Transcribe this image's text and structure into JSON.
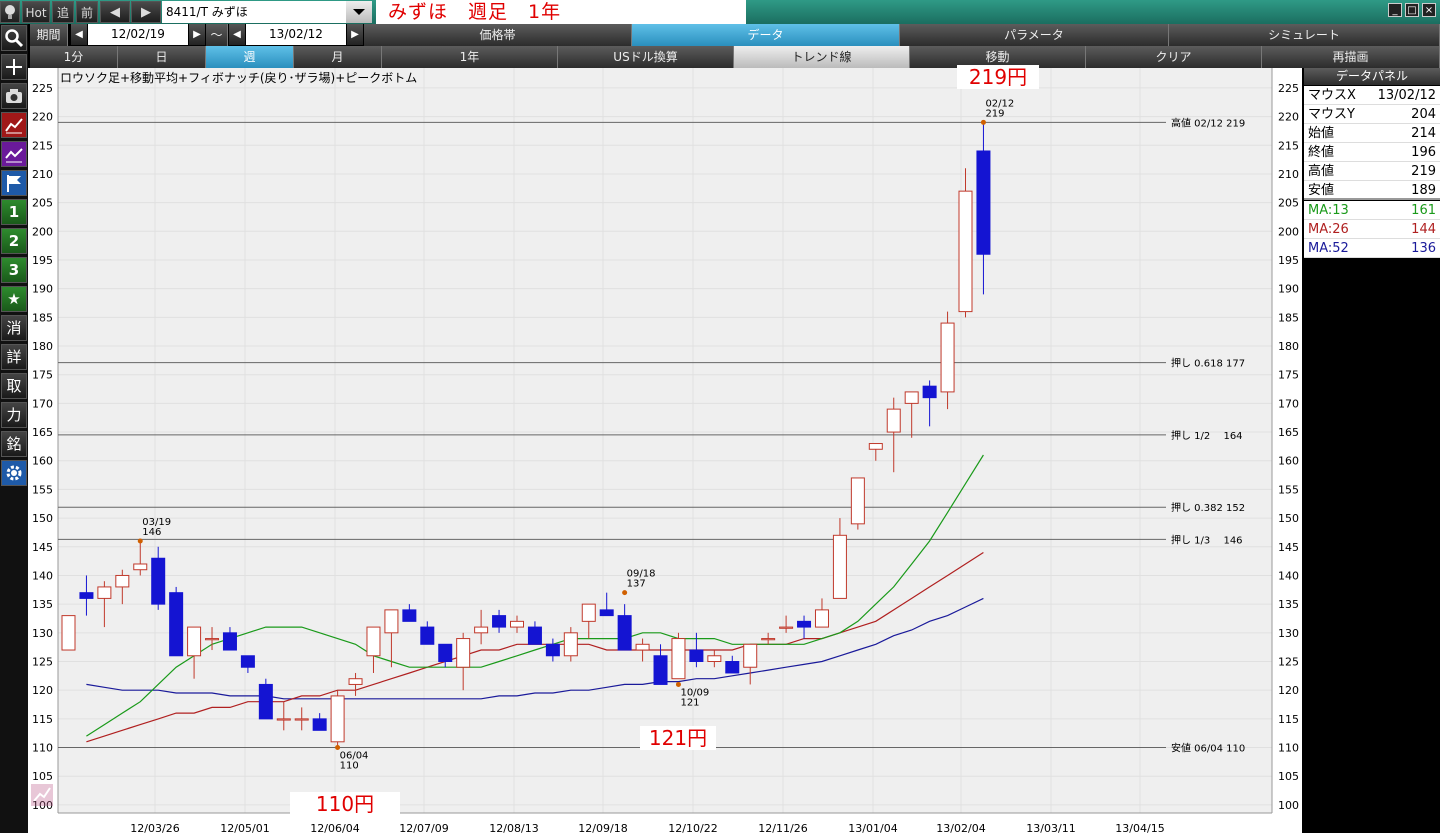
{
  "toolbar": {
    "hot": "Hot",
    "tsui": "追",
    "mae": "前",
    "prev": "◀",
    "next": "▶",
    "symbol": "8411/T みずほ",
    "title": "みずほ　週足　1年",
    "win_min": "_",
    "win_max": "□",
    "win_close": "×"
  },
  "left_tools": [
    "search-icon",
    "plus-icon",
    "camera-icon",
    "chart-line-icon",
    "chart-purple-icon",
    "flag-icon",
    "1",
    "2",
    "3",
    "★",
    "消",
    "詳",
    "取",
    "力",
    "銘",
    "gear-icon"
  ],
  "period": {
    "label": "期間",
    "from": "12/02/19",
    "tilde": "～",
    "to": "13/02/12"
  },
  "row1_tabs": [
    {
      "label": "価格帯",
      "selected": false
    },
    {
      "label": "データ",
      "selected": true
    },
    {
      "label": "パラメータ",
      "selected": false
    },
    {
      "label": "シミュレート",
      "selected": false
    }
  ],
  "row2_tabs": [
    {
      "label": "1分",
      "selected": false
    },
    {
      "label": "日",
      "selected": false
    },
    {
      "label": "週",
      "selected": true
    },
    {
      "label": "月",
      "selected": false
    },
    {
      "label": "1年",
      "selected": false
    },
    {
      "label": "USドル換算",
      "selected": false
    },
    {
      "label": "トレンド線",
      "selected": false
    },
    {
      "label": "移動",
      "selected": false
    },
    {
      "label": "クリア",
      "selected": false
    },
    {
      "label": "再描画",
      "selected": false
    }
  ],
  "chart_title": "ロウソク足+移動平均+フィボナッチ(戻り･ザラ場)+ピークボトム",
  "chart_data": {
    "type": "candlestick",
    "ylim": [
      100,
      228
    ],
    "yticks": [
      100,
      105,
      110,
      115,
      120,
      125,
      130,
      135,
      140,
      145,
      150,
      155,
      160,
      165,
      170,
      175,
      180,
      185,
      190,
      195,
      200,
      205,
      210,
      215,
      220,
      225
    ],
    "xticks": [
      "12/03/26",
      "12/05/01",
      "12/06/04",
      "12/07/09",
      "12/08/13",
      "12/09/18",
      "12/10/22",
      "12/11/26",
      "13/01/04",
      "13/02/04",
      "13/03/11",
      "13/04/15"
    ],
    "candles": [
      {
        "o": 127,
        "h": 133,
        "l": 127,
        "c": 133
      },
      {
        "o": 137,
        "h": 140,
        "l": 133,
        "c": 136
      },
      {
        "o": 136,
        "h": 139,
        "l": 131,
        "c": 138
      },
      {
        "o": 138,
        "h": 141,
        "l": 135,
        "c": 140
      },
      {
        "o": 141,
        "h": 146,
        "l": 140,
        "c": 142
      },
      {
        "o": 143,
        "h": 145,
        "l": 134,
        "c": 135
      },
      {
        "o": 137,
        "h": 138,
        "l": 126,
        "c": 126
      },
      {
        "o": 126,
        "h": 131,
        "l": 122,
        "c": 131
      },
      {
        "o": 129,
        "h": 131,
        "l": 127,
        "c": 129
      },
      {
        "o": 130,
        "h": 131,
        "l": 127,
        "c": 127
      },
      {
        "o": 126,
        "h": 126,
        "l": 123,
        "c": 124
      },
      {
        "o": 121,
        "h": 122,
        "l": 115,
        "c": 115
      },
      {
        "o": 115,
        "h": 118,
        "l": 113,
        "c": 115
      },
      {
        "o": 115,
        "h": 117,
        "l": 113,
        "c": 115
      },
      {
        "o": 115,
        "h": 116,
        "l": 113,
        "c": 113
      },
      {
        "o": 111,
        "h": 120,
        "l": 110,
        "c": 119
      },
      {
        "o": 121,
        "h": 123,
        "l": 119,
        "c": 122
      },
      {
        "o": 126,
        "h": 131,
        "l": 123,
        "c": 131
      },
      {
        "o": 130,
        "h": 134,
        "l": 124,
        "c": 134
      },
      {
        "o": 134,
        "h": 135,
        "l": 132,
        "c": 132
      },
      {
        "o": 131,
        "h": 132,
        "l": 128,
        "c": 128
      },
      {
        "o": 128,
        "h": 128,
        "l": 124,
        "c": 125
      },
      {
        "o": 124,
        "h": 130,
        "l": 120,
        "c": 129
      },
      {
        "o": 130,
        "h": 134,
        "l": 128,
        "c": 131
      },
      {
        "o": 133,
        "h": 134,
        "l": 130,
        "c": 131
      },
      {
        "o": 131,
        "h": 133,
        "l": 130,
        "c": 132
      },
      {
        "o": 131,
        "h": 132,
        "l": 128,
        "c": 128
      },
      {
        "o": 128,
        "h": 129,
        "l": 125,
        "c": 126
      },
      {
        "o": 126,
        "h": 131,
        "l": 125,
        "c": 130
      },
      {
        "o": 132,
        "h": 135,
        "l": 129,
        "c": 135
      },
      {
        "o": 134,
        "h": 137,
        "l": 133,
        "c": 133
      },
      {
        "o": 133,
        "h": 135,
        "l": 127,
        "c": 127
      },
      {
        "o": 127,
        "h": 129,
        "l": 125,
        "c": 128
      },
      {
        "o": 126,
        "h": 128,
        "l": 121,
        "c": 121
      },
      {
        "o": 122,
        "h": 130,
        "l": 122,
        "c": 129
      },
      {
        "o": 127,
        "h": 130,
        "l": 124,
        "c": 125
      },
      {
        "o": 125,
        "h": 127,
        "l": 124,
        "c": 126
      },
      {
        "o": 125,
        "h": 126,
        "l": 123,
        "c": 123
      },
      {
        "o": 124,
        "h": 128,
        "l": 121,
        "c": 128
      },
      {
        "o": 129,
        "h": 130,
        "l": 128,
        "c": 129
      },
      {
        "o": 131,
        "h": 133,
        "l": 130,
        "c": 131
      },
      {
        "o": 132,
        "h": 133,
        "l": 129,
        "c": 131
      },
      {
        "o": 131,
        "h": 136,
        "l": 131,
        "c": 134
      },
      {
        "o": 136,
        "h": 150,
        "l": 136,
        "c": 147
      },
      {
        "o": 149,
        "h": 157,
        "l": 148,
        "c": 157
      },
      {
        "o": 162,
        "h": 163,
        "l": 160,
        "c": 163
      },
      {
        "o": 165,
        "h": 171,
        "l": 158,
        "c": 169
      },
      {
        "o": 170,
        "h": 172,
        "l": 164,
        "c": 172
      },
      {
        "o": 173,
        "h": 174,
        "l": 166,
        "c": 171
      },
      {
        "o": 172,
        "h": 186,
        "l": 169,
        "c": 184
      },
      {
        "o": 186,
        "h": 211,
        "l": 185,
        "c": 207
      },
      {
        "o": 214,
        "h": 219,
        "l": 189,
        "c": 196
      }
    ],
    "ma13": [
      112,
      114,
      116,
      118,
      121,
      124,
      126,
      128,
      129,
      130,
      131,
      131,
      131,
      130,
      129,
      128,
      126,
      125,
      124,
      124,
      124,
      124,
      124,
      125,
      126,
      127,
      128,
      129,
      129,
      129,
      129,
      130,
      130,
      129,
      129,
      129,
      128,
      128,
      128,
      128,
      128,
      129,
      130,
      132,
      135,
      138,
      142,
      146,
      151,
      156,
      161
    ],
    "ma26": [
      111,
      112,
      113,
      114,
      115,
      116,
      116,
      117,
      117,
      118,
      118,
      118,
      119,
      119,
      120,
      120,
      121,
      122,
      123,
      124,
      125,
      126,
      127,
      127,
      128,
      128,
      128,
      128,
      128,
      127,
      127,
      127,
      127,
      127,
      127,
      127,
      127,
      128,
      128,
      128,
      129,
      129,
      130,
      131,
      132,
      134,
      136,
      138,
      140,
      142,
      144
    ],
    "ma52": [
      121,
      120.5,
      120,
      120,
      120,
      119.5,
      119.5,
      119.5,
      119,
      119,
      119,
      118.5,
      118.5,
      118.5,
      118.5,
      118.5,
      118.5,
      118.5,
      118.5,
      118.5,
      118.5,
      118.5,
      118.5,
      119,
      119,
      119.5,
      119.5,
      120,
      120,
      120.5,
      121,
      121,
      121.5,
      121.5,
      122,
      122,
      122.5,
      123,
      123.5,
      124,
      124.5,
      125,
      126,
      127,
      128,
      129.5,
      130.5,
      132,
      133,
      134.5,
      136
    ],
    "hlines": [
      {
        "y": 219,
        "label": "高値 02/12 219"
      },
      {
        "y": 177.1,
        "label": "押し 0.618 177"
      },
      {
        "y": 164.5,
        "label": "押し 1/2　 164"
      },
      {
        "y": 151.9,
        "label": "押し 0.382 152"
      },
      {
        "y": 146.3,
        "label": "押し 1/3　 146"
      },
      {
        "y": 110,
        "label": "安値 06/04 110"
      }
    ],
    "peaks": [
      {
        "i": 4,
        "y": 146,
        "date": "03/19",
        "val": "146",
        "pos": "above"
      },
      {
        "i": 31,
        "y": 137,
        "date": "09/18",
        "val": "137",
        "pos": "above"
      },
      {
        "i": 51,
        "y": 219,
        "date": "02/12",
        "val": "219",
        "pos": "above"
      },
      {
        "i": 15,
        "y": 110,
        "date": "06/04",
        "val": "110",
        "pos": "below"
      },
      {
        "i": 34,
        "y": 121,
        "date": "10/09",
        "val": "121",
        "pos": "below"
      }
    ]
  },
  "annotations": [
    {
      "text": "219円"
    },
    {
      "text": "121円"
    },
    {
      "text": "110円"
    }
  ],
  "panel": {
    "title": "データパネル",
    "rows": [
      {
        "k": "マウスX",
        "v": "13/02/12"
      },
      {
        "k": "マウスY",
        "v": "204"
      },
      {
        "k": "始値",
        "v": "214"
      },
      {
        "k": "終値",
        "v": "196"
      },
      {
        "k": "高値",
        "v": "219"
      },
      {
        "k": "安値",
        "v": "189"
      },
      {
        "k": "MA:13",
        "v": "161"
      },
      {
        "k": "MA:26",
        "v": "144"
      },
      {
        "k": "MA:52",
        "v": "136"
      }
    ]
  },
  "colors": {
    "up": "#c0392b",
    "down": "#1414d2",
    "ma13": "#1a9a1a",
    "ma26": "#b02020",
    "ma52": "#1a1a9a",
    "accent": "#e00000"
  }
}
